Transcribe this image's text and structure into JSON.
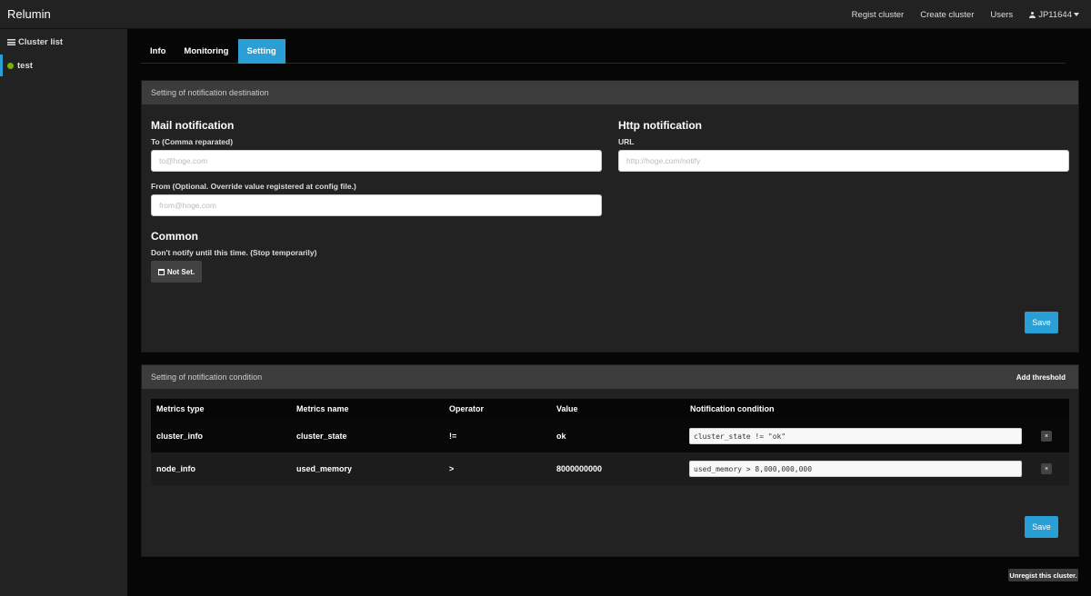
{
  "app": {
    "title": "Relumin"
  },
  "nav": {
    "regist_cluster": "Regist cluster",
    "create_cluster": "Create cluster",
    "users": "Users",
    "user_name": "JP11644"
  },
  "sidebar": {
    "title": "Cluster list",
    "clusters": [
      {
        "name": "test",
        "status_color": "#77b300"
      }
    ]
  },
  "tabs": [
    {
      "label": "Info",
      "active": false
    },
    {
      "label": "Monitoring",
      "active": false
    },
    {
      "label": "Setting",
      "active": true
    }
  ],
  "destination": {
    "panel_title": "Setting of notification destination",
    "mail": {
      "heading": "Mail notification",
      "to_label": "To (Comma reparated)",
      "to_value": "",
      "to_placeholder": "to@hoge.com",
      "from_label": "From (Optional. Override value registered at config file.)",
      "from_value": "",
      "from_placeholder": "from@hoge.com"
    },
    "http": {
      "heading": "Http notification",
      "url_label": "URL",
      "url_value": "",
      "url_placeholder": "http://hoge.com/notify"
    },
    "common": {
      "heading": "Common",
      "stop_label": "Don't notify until this time. (Stop temporarily)",
      "not_set_label": "Not Set."
    },
    "save_label": "Save"
  },
  "condition": {
    "panel_title": "Setting of notification condition",
    "add_threshold_label": "Add threshold",
    "columns": [
      "Metrics type",
      "Metrics name",
      "Operator",
      "Value",
      "Notification condition"
    ],
    "rows": [
      {
        "metrics_type": "cluster_info",
        "metrics_name": "cluster_state",
        "operator": "!=",
        "value": "ok",
        "condition": "cluster_state != \"ok\"",
        "delete": "×"
      },
      {
        "metrics_type": "node_info",
        "metrics_name": "used_memory",
        "operator": ">",
        "value": "8000000000",
        "condition": "used_memory > 8,000,000,000",
        "delete": "×"
      }
    ],
    "save_label": "Save"
  },
  "footer": {
    "unregist_label": "Unregist this cluster."
  },
  "colors": {
    "accent": "#2a9fd6",
    "status_ok": "#77b300"
  }
}
